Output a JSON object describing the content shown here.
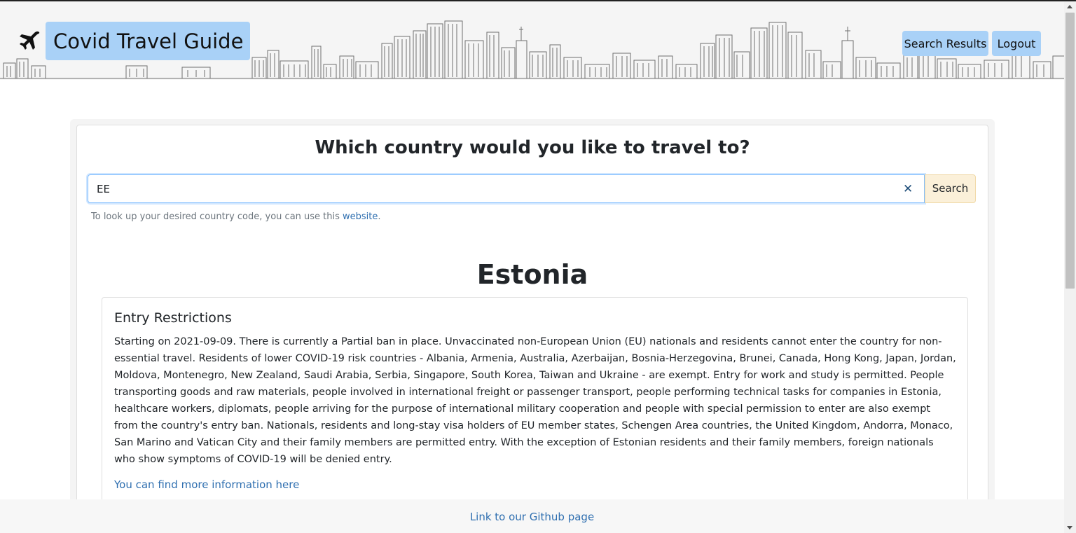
{
  "header": {
    "brand": "Covid Travel Guide",
    "brand_icon": "airplane-icon",
    "nav": {
      "search_results": "Search Results",
      "logout": "Logout"
    }
  },
  "search": {
    "question": "Which country would you like to travel to?",
    "value": "EE",
    "clear_icon": "close-icon",
    "button": "Search",
    "hint_prefix": "To look up your desired country code, you can use this ",
    "hint_link": "website",
    "hint_suffix": "."
  },
  "result": {
    "country": "Estonia",
    "section_title": "Entry Restrictions",
    "text": "Starting on 2021-09-09. There is currently a Partial ban in place. Unvaccinated non-European Union (EU) nationals and residents cannot enter the country for non-essential travel. Residents of lower COVID-19 risk countries - Albania, Armenia, Australia, Azerbaijan, Bosnia-Herzegovina, Brunei, Canada, Hong Kong, Japan, Jordan, Moldova, Montenegro, New Zealand, Saudi Arabia, Serbia, Singapore, South Korea, Taiwan and Ukraine - are exempt. Entry for work and study is permitted. People transporting goods and raw materials, people involved in international freight or passenger transport, people performing technical tasks for companies in Estonia, healthcare workers, diplomats, people arriving for the purpose of international military cooperation and people with special permission to enter are also exempt from the country's entry ban. Nationals, residents and long-stay visa holders of EU member states, Schengen Area countries, the United Kingdom, Andorra, Monaco, San Marino and Vatican City and their family members are permitted entry. With the exception of Estonian residents and their family members, foreign nationals who show symptoms of COVID-19 will be denied entry.",
    "more_link": "You can find more information here"
  },
  "footer": {
    "github_link": "Link to our Github page"
  },
  "colors": {
    "nav_button_bg": "#a9d1f7",
    "search_button_bg": "#fbf0d9",
    "link": "#2f6fb0",
    "header_bg": "#f5f5f5"
  }
}
